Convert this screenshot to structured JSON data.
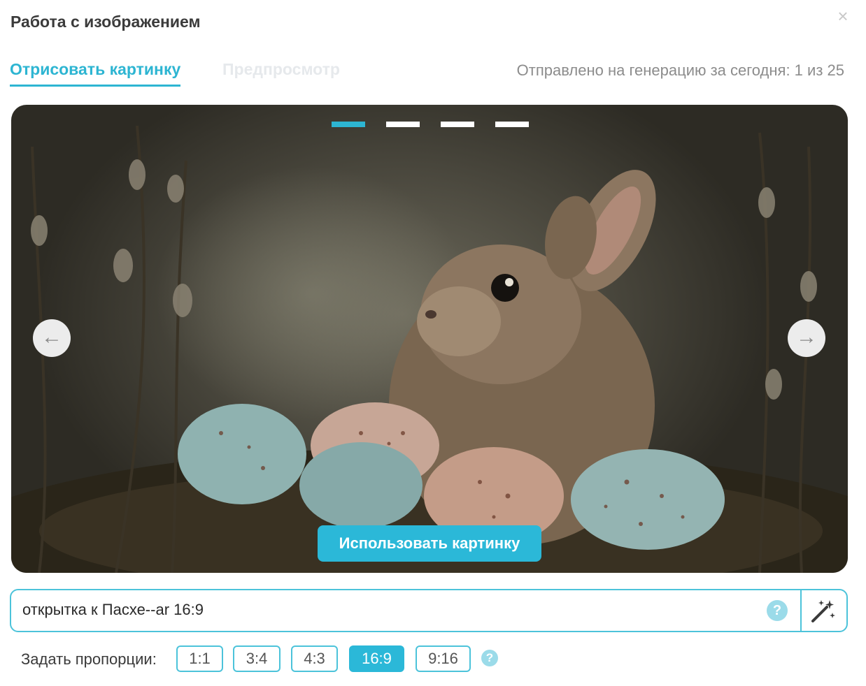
{
  "dialog": {
    "title": "Работа с изображением",
    "close_icon": "close-icon",
    "close_glyph": "×"
  },
  "tabs": [
    {
      "label": "Отрисовать картинку",
      "active": true
    },
    {
      "label": "Предпросмотр",
      "active": false
    }
  ],
  "counter": "Отправлено на генерацию за сегодня: 1 из 25",
  "viewer": {
    "image_alt": "Easter bunny with speckled eggs",
    "slide_count": 4,
    "active_slide": 1,
    "prev_icon": "arrow-left-icon",
    "prev_glyph": "←",
    "next_icon": "arrow-right-icon",
    "next_glyph": "→",
    "use_button": "Использовать картинку"
  },
  "prompt": {
    "value": "открытка к Пасхе--ar 16:9",
    "help_glyph": "?",
    "generate_icon": "magic-wand-icon"
  },
  "ratios": {
    "label": "Задать пропорции:",
    "options": [
      "1:1",
      "3:4",
      "4:3",
      "16:9",
      "9:16"
    ],
    "selected": "16:9",
    "help_glyph": "?"
  },
  "colors": {
    "accent": "#2bb8d8",
    "accent_light": "#9bdbe9",
    "counter_text": "#8c8c8c"
  }
}
